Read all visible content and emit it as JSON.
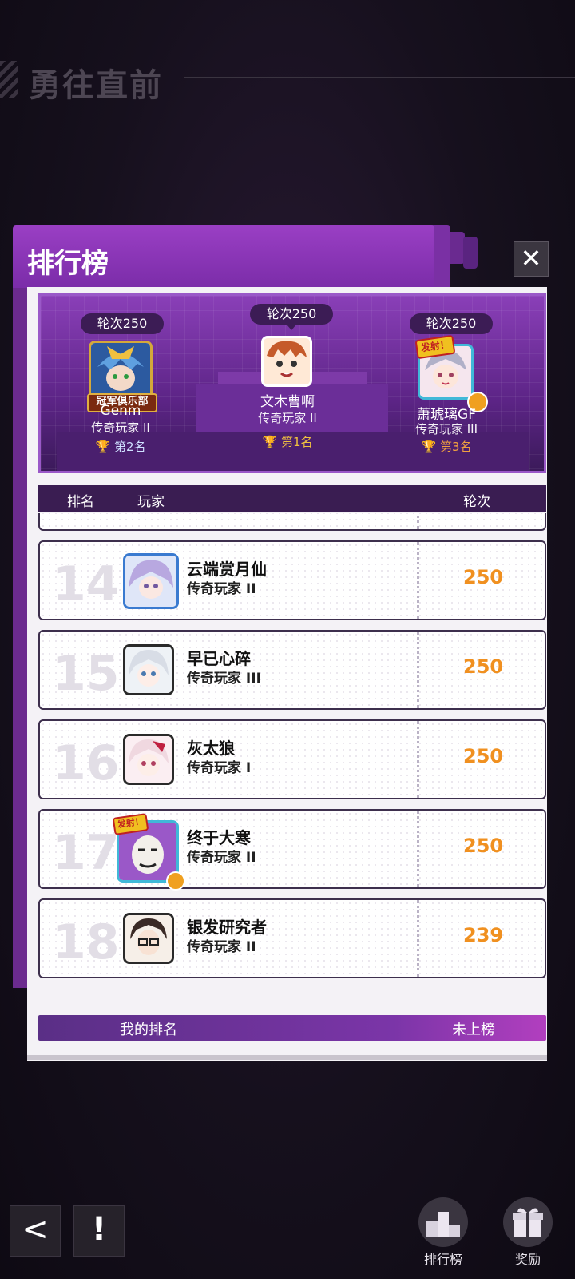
{
  "background_title": "勇往直前",
  "panel": {
    "title": "排行榜",
    "close_label": "✕"
  },
  "podium": {
    "first": {
      "rounds": "轮次250",
      "name": "文木曹啊",
      "title": "传奇玩家 II",
      "rank": "第1名"
    },
    "second": {
      "rounds": "轮次250",
      "name": "Genm",
      "title": "传奇玩家 II",
      "rank": "第2名",
      "badge": "冠军俱乐部"
    },
    "third": {
      "rounds": "轮次250",
      "name": "萧琥璃GF",
      "title": "传奇玩家 III",
      "rank": "第3名",
      "badge": "发射！"
    }
  },
  "columns": {
    "rank": "排名",
    "player": "玩家",
    "rounds": "轮次"
  },
  "rows": [
    {
      "rank": "14",
      "name": "云端赏月仙",
      "title": "传奇玩家 II",
      "score": "250"
    },
    {
      "rank": "15",
      "name": "早已心碎",
      "title": "传奇玩家 III",
      "score": "250"
    },
    {
      "rank": "16",
      "name": "灰太狼",
      "title": "传奇玩家 I",
      "score": "250"
    },
    {
      "rank": "17",
      "name": "终于大寒",
      "title": "传奇玩家 II",
      "score": "250",
      "badge": "发射！"
    },
    {
      "rank": "18",
      "name": "银发研究者",
      "title": "传奇玩家 II",
      "score": "239"
    }
  ],
  "my_rank": {
    "label": "我的排名",
    "value": "未上榜"
  },
  "bottom": {
    "leaderboard_label": "排行榜",
    "rewards_label": "奖励"
  },
  "colors": {
    "accent": "#8a3fb8",
    "score": "#f09020",
    "gold": "#f0c040",
    "bronze": "#f0a040"
  }
}
